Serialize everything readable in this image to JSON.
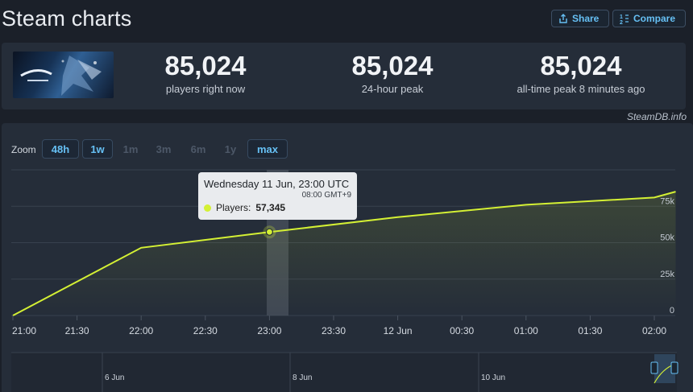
{
  "page": {
    "title": "Steam charts"
  },
  "header": {
    "share_label": "Share",
    "compare_label": "Compare"
  },
  "stats": [
    {
      "value": "85,024",
      "label": "players right now"
    },
    {
      "value": "85,024",
      "label": "24-hour peak"
    },
    {
      "value": "85,024",
      "label": "all-time peak 8 minutes ago"
    }
  ],
  "credit": "SteamDB.info",
  "zoom": {
    "label": "Zoom",
    "options": [
      "48h",
      "1w",
      "1m",
      "3m",
      "6m",
      "1y",
      "max"
    ],
    "active": [
      "48h",
      "1w",
      "max"
    ]
  },
  "tooltip": {
    "date": "Wednesday 11 Jun, 23:00 UTC",
    "local_time": "08:00 GMT+9",
    "series_label": "Players:",
    "series_value": "57,345"
  },
  "navigator": {
    "labels": [
      "6 Jun",
      "8 Jun",
      "10 Jun"
    ]
  },
  "colors": {
    "series": "#d4f034",
    "accent": "#66c0f4",
    "panel": "#252d39",
    "background": "#1b2029"
  },
  "chart_data": {
    "type": "line",
    "x_labels": [
      "21:00",
      "21:30",
      "22:00",
      "22:30",
      "23:00",
      "23:30",
      "12 Jun",
      "00:30",
      "01:00",
      "01:30",
      "02:00"
    ],
    "y_ticks": [
      "0",
      "25k",
      "50k",
      "75k"
    ],
    "ylim": [
      0,
      100000
    ],
    "series": [
      {
        "name": "Players",
        "points": [
          {
            "x": "21:00",
            "y": 0
          },
          {
            "x": "22:00",
            "y": 46500
          },
          {
            "x": "23:00",
            "y": 57345
          },
          {
            "x": "00:00",
            "y": 67500
          },
          {
            "x": "01:00",
            "y": 76000
          },
          {
            "x": "02:00",
            "y": 81000
          },
          {
            "x": "02:10",
            "y": 85024
          }
        ]
      }
    ],
    "highlight": {
      "x": "23:00",
      "y": 57345
    },
    "grid": true
  }
}
